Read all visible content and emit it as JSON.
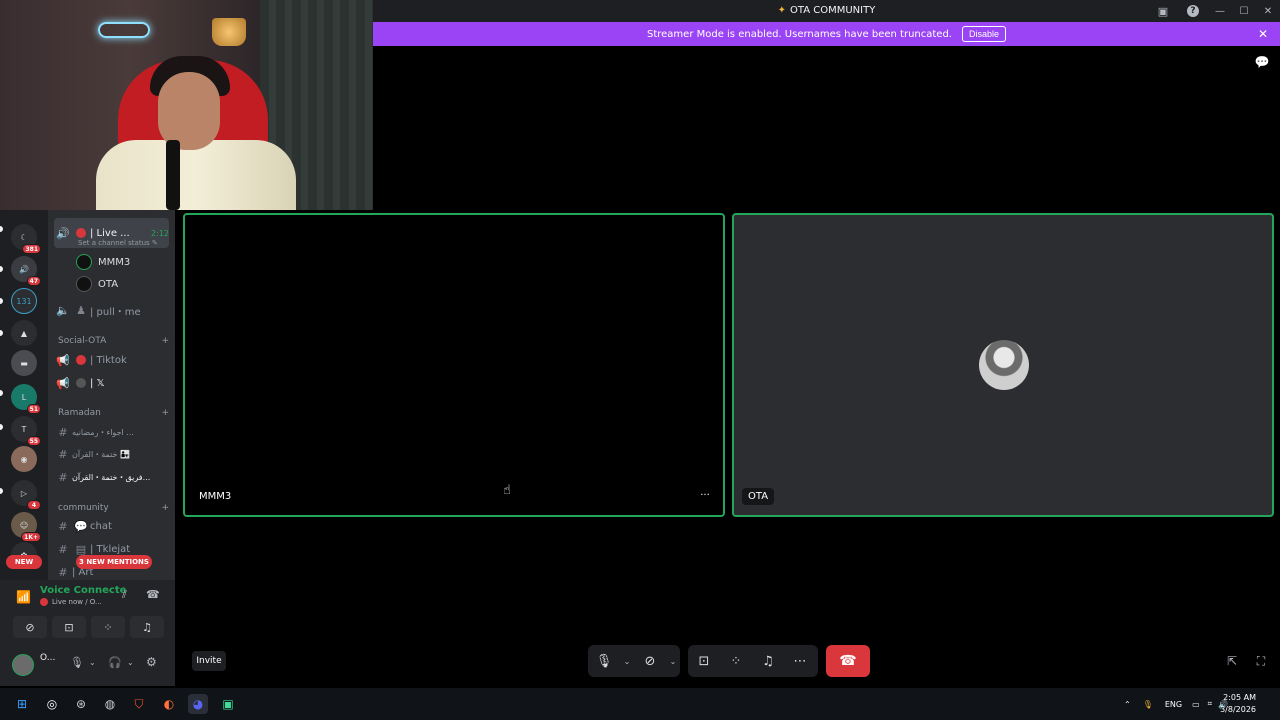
{
  "window": {
    "title": "OTA COMMUNITY",
    "controls": [
      "minimize",
      "maximize",
      "close"
    ]
  },
  "banner": {
    "message": "Streamer Mode is enabled. Usernames have been truncated.",
    "disable_label": "Disable"
  },
  "servers": [
    {
      "badge": "381"
    },
    {
      "badge": "47"
    },
    {
      "badge": ""
    },
    {
      "badge": ""
    },
    {
      "badge": ""
    },
    {
      "badge": "51"
    },
    {
      "badge": "55"
    },
    {
      "badge": ""
    },
    {
      "badge": "4"
    },
    {
      "badge": "1K+"
    }
  ],
  "new_label": "NEW",
  "channels": {
    "active_voice": {
      "name": "| Live ...",
      "timer": "2:12",
      "status": "Set a channel status"
    },
    "voice_users": [
      "MMM3",
      "OTA"
    ],
    "pull_channel": "| pull・me",
    "categories": [
      {
        "name": "Social-OTA",
        "channels": [
          "| Tiktok",
          "| 𝕏"
        ]
      },
      {
        "name": "Ramadan",
        "channels": [
          "اجواء・رمضانيه ...",
          "ختمة・القرآن 👨‍👧",
          "فريق・ختمة・القرآن..."
        ]
      },
      {
        "name": "community",
        "channels": [
          "chat",
          "| Tklejat",
          "| Art"
        ]
      }
    ],
    "mentions_label": "3 NEW MENTIONS"
  },
  "voice_panel": {
    "title": "Voice Connecte",
    "subtitle": "Live now / O..."
  },
  "user_panel": {
    "name": "O..."
  },
  "tiles": [
    {
      "name": "MMM3",
      "more": "···"
    },
    {
      "name": "OTA"
    }
  ],
  "controls": {
    "invite_label": "Invite"
  },
  "taskbar": {
    "language": "ENG",
    "time": "2:05 AM",
    "date": "3/8/2026"
  },
  "colors": {
    "accent_green": "#23a55a",
    "banner_purple": "#9b44f5",
    "danger_red": "#da373c"
  }
}
